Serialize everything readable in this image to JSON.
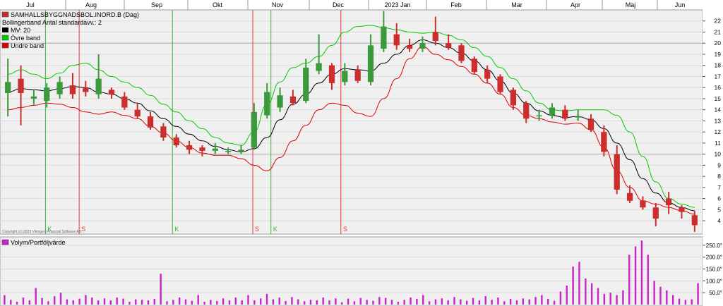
{
  "chart_data": [
    {
      "type": "candlestick",
      "title": "SAMHALLSBYGGNADSBOL.INORD.B (Dag)",
      "subtitle": "Bollingerband  Antal standardavv.: 2",
      "x_months": [
        "Jul",
        "Aug",
        "Sep",
        "Okt",
        "Nov",
        "Dec",
        "2023 Jan",
        "Feb",
        "Mar",
        "Apr",
        "Maj",
        "Jun"
      ],
      "y_ticks": [
        22,
        21,
        20,
        19,
        18,
        17,
        16,
        15,
        14,
        13,
        12,
        11,
        10,
        9,
        8,
        7,
        6,
        5,
        4
      ],
      "y_range": [
        2.8,
        23.0
      ],
      "grid": true,
      "legend_position": "top-left",
      "series": [
        {
          "name": "MV: 20",
          "color": "#000000",
          "values": [
            15.6,
            15.9,
            15.8,
            15.7,
            15.9,
            16.1,
            16.0,
            15.6,
            15.4,
            15.0,
            14.6,
            13.9,
            13.2,
            12.5,
            11.8,
            11.2,
            10.7,
            10.4,
            10.2,
            10.5,
            11.5,
            13.1,
            14.5,
            15.4,
            16.4,
            17.2,
            17.7,
            17.6,
            17.5,
            18.2,
            19.0,
            19.8,
            20.3,
            20.0,
            19.6,
            19.1,
            18.4,
            17.6,
            16.6,
            15.5,
            14.6,
            13.9,
            13.5,
            13.3,
            13.4,
            13.1,
            12.3,
            11.0,
            9.5,
            7.8,
            6.5,
            5.6,
            5.2,
            4.9
          ]
        },
        {
          "name": "Övre band",
          "color": "#00cc00",
          "values": [
            17.2,
            17.6,
            17.2,
            16.8,
            17.3,
            18.0,
            18.2,
            17.6,
            17.0,
            16.5,
            16.0,
            15.3,
            14.5,
            13.8,
            13.0,
            12.3,
            11.5,
            11.0,
            10.8,
            12.0,
            14.5,
            16.5,
            17.8,
            18.2,
            18.8,
            19.8,
            21.0,
            21.5,
            21.6,
            21.4,
            21.2,
            21.0,
            20.9,
            21.0,
            20.7,
            20.3,
            19.6,
            18.8,
            17.8,
            16.8,
            15.7,
            14.6,
            14.0,
            13.9,
            14.0,
            14.0,
            14.0,
            13.5,
            12.0,
            9.8,
            7.5,
            6.0,
            5.5,
            5.2
          ]
        },
        {
          "name": "Undre band",
          "color": "#dd0000",
          "values": [
            14.0,
            14.2,
            14.4,
            14.6,
            14.5,
            14.2,
            13.8,
            13.6,
            13.8,
            13.5,
            13.2,
            12.5,
            11.9,
            11.2,
            10.6,
            10.1,
            9.9,
            9.9,
            9.6,
            9.0,
            8.5,
            9.7,
            11.2,
            12.6,
            14.0,
            14.6,
            14.4,
            13.7,
            13.4,
            15.0,
            16.8,
            18.6,
            19.7,
            19.0,
            18.5,
            17.9,
            17.2,
            16.4,
            15.4,
            14.2,
            13.5,
            13.2,
            12.9,
            12.7,
            12.8,
            12.2,
            10.6,
            8.5,
            7.0,
            5.8,
            5.5,
            5.2,
            4.9,
            4.6
          ]
        }
      ],
      "price": {
        "open": [
          15.5,
          16.8,
          15.0,
          14.8,
          15.4,
          16.2,
          16.0,
          15.4,
          15.8,
          15.2,
          14.0,
          13.4,
          12.5,
          11.5,
          10.8,
          10.6,
          10.3,
          10.2,
          10.2,
          10.6,
          13.5,
          14.2,
          15.2,
          14.8,
          17.5,
          18.0,
          16.5,
          17.6,
          16.5,
          19.5,
          20.8,
          19.8,
          19.5,
          21.0,
          20.0,
          19.8,
          18.6,
          17.6,
          17.0,
          15.8,
          14.6,
          13.4,
          13.5,
          14.0,
          13.3,
          13.2,
          12.0,
          10.0,
          6.5,
          5.8,
          5.2,
          6.0,
          5.2,
          4.5
        ],
        "close": [
          16.5,
          15.5,
          15.2,
          16.0,
          16.5,
          15.4,
          15.6,
          16.8,
          15.4,
          14.2,
          13.4,
          12.4,
          11.5,
          10.8,
          10.4,
          10.3,
          10.5,
          10.3,
          10.4,
          13.8,
          15.6,
          15.3,
          14.6,
          17.8,
          18.2,
          16.4,
          17.5,
          16.6,
          19.8,
          21.5,
          19.8,
          19.5,
          20.0,
          20.2,
          19.6,
          18.4,
          17.4,
          16.8,
          15.6,
          14.4,
          13.2,
          13.5,
          14.2,
          13.2,
          13.4,
          12.2,
          10.2,
          6.8,
          5.8,
          5.2,
          4.2,
          5.4,
          4.8,
          3.6
        ],
        "high": [
          18.6,
          18.0,
          15.8,
          16.4,
          17.0,
          17.3,
          16.6,
          19.0,
          16.0,
          15.6,
          14.6,
          13.8,
          12.8,
          11.8,
          11.2,
          10.8,
          11.0,
          10.6,
          10.8,
          14.6,
          16.4,
          16.0,
          15.8,
          18.6,
          20.8,
          18.2,
          18.2,
          18.0,
          20.8,
          22.9,
          21.8,
          20.4,
          20.6,
          22.4,
          20.8,
          20.0,
          18.8,
          18.0,
          17.2,
          16.0,
          14.8,
          14.0,
          14.6,
          14.4,
          14.0,
          13.6,
          12.6,
          10.8,
          7.2,
          6.2,
          5.6,
          6.6,
          5.4,
          4.9
        ],
        "low": [
          13.4,
          12.6,
          14.4,
          14.2,
          15.0,
          15.0,
          15.2,
          15.0,
          15.0,
          14.0,
          13.2,
          12.2,
          11.2,
          10.6,
          10.0,
          9.8,
          10.0,
          10.0,
          10.0,
          10.4,
          13.2,
          13.8,
          14.4,
          14.6,
          17.2,
          15.8,
          16.2,
          16.4,
          16.2,
          19.2,
          19.4,
          19.2,
          19.2,
          19.8,
          19.4,
          18.2,
          17.2,
          16.4,
          15.4,
          14.0,
          12.8,
          13.0,
          13.2,
          13.0,
          13.0,
          12.0,
          9.8,
          6.4,
          5.6,
          5.0,
          3.5,
          4.6,
          4.2,
          3.0
        ],
        "up_color": "#3c9a3c",
        "down_color": "#cc2e2e"
      },
      "signals": [
        {
          "x": 3.4,
          "label": "K",
          "type": "buy"
        },
        {
          "x": 6.0,
          "label": "S",
          "type": "sell"
        },
        {
          "x": 13.2,
          "label": "K",
          "type": "buy"
        },
        {
          "x": 19.4,
          "label": "S",
          "type": "sell"
        },
        {
          "x": 20.8,
          "label": "K",
          "type": "buy"
        },
        {
          "x": 26.2,
          "label": "S",
          "type": "sell"
        }
      ],
      "signal_colors": {
        "buy": "#33bb33",
        "sell": "#ee3333"
      },
      "copyright": "Copyright (c) 2023 Vikingen Financial Software AB"
    },
    {
      "type": "bar",
      "title": "Volym/Portföljvärde",
      "y_ticks": [
        "250.0°",
        "200.0°",
        "150.0°",
        "100.0°",
        "50.0°"
      ],
      "y_tick_values": [
        250,
        200,
        150,
        100,
        50
      ],
      "y_range": [
        0,
        285
      ],
      "bar_color": "#cc22cc",
      "values": [
        40,
        20,
        12,
        30,
        18,
        70,
        28,
        14,
        35,
        50,
        22,
        18,
        25,
        40,
        30,
        18,
        26,
        18,
        30,
        25,
        12,
        22,
        20,
        18,
        24,
        130,
        14,
        20,
        30,
        22,
        16,
        40,
        12,
        20,
        15,
        26,
        18,
        30,
        18,
        40,
        18,
        26,
        45,
        22,
        30,
        15,
        32,
        22,
        14,
        20,
        18,
        30,
        18,
        26,
        10,
        25,
        14,
        28,
        20,
        16,
        32,
        28,
        20,
        12,
        20,
        30,
        24,
        40,
        14,
        22,
        26,
        18,
        32,
        22,
        16,
        28,
        18,
        36,
        20,
        30,
        14,
        24,
        18,
        26,
        22,
        32,
        40,
        24,
        16,
        55,
        80,
        160,
        180,
        110,
        90,
        70,
        45,
        50,
        40,
        60,
        210,
        245,
        270,
        210,
        100,
        75,
        60,
        40,
        25,
        20,
        22,
        90
      ]
    }
  ]
}
